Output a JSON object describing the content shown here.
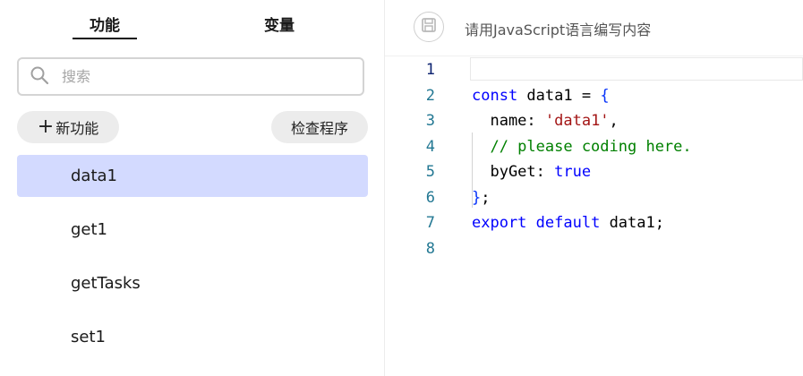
{
  "tabs": {
    "functions_label": "功能",
    "variables_label": "变量"
  },
  "search": {
    "placeholder": "搜索",
    "value": ""
  },
  "buttons": {
    "new_function_plus": "+",
    "new_function_label": "新功能",
    "check_program_label": "检查程序"
  },
  "function_list": [
    {
      "label": "data1",
      "active": true
    },
    {
      "label": "get1",
      "active": false
    },
    {
      "label": "getTasks",
      "active": false
    },
    {
      "label": "set1",
      "active": false
    }
  ],
  "editor": {
    "hint": "请用JavaScript语言编写内容",
    "save_icon": "save-icon",
    "lines": [
      {
        "number": "1",
        "tokens": []
      },
      {
        "number": "2",
        "tokens": [
          {
            "t": "const",
            "c": "kw"
          },
          {
            "t": " data1 = ",
            "c": ""
          },
          {
            "t": "{",
            "c": "br"
          }
        ]
      },
      {
        "number": "3",
        "tokens": [
          {
            "t": "  name: ",
            "c": ""
          },
          {
            "t": "'data1'",
            "c": "str"
          },
          {
            "t": ",",
            "c": ""
          }
        ]
      },
      {
        "number": "4",
        "tokens": [
          {
            "t": "  // please coding here.",
            "c": "cmt"
          }
        ]
      },
      {
        "number": "5",
        "tokens": [
          {
            "t": "  byGet: ",
            "c": ""
          },
          {
            "t": "true",
            "c": "kw"
          }
        ]
      },
      {
        "number": "6",
        "tokens": [
          {
            "t": "}",
            "c": "br"
          },
          {
            "t": ";",
            "c": ""
          }
        ]
      },
      {
        "number": "7",
        "tokens": [
          {
            "t": "export",
            "c": "kw"
          },
          {
            "t": " ",
            "c": ""
          },
          {
            "t": "default",
            "c": "kw"
          },
          {
            "t": " data1;",
            "c": ""
          }
        ]
      },
      {
        "number": "8",
        "tokens": []
      }
    ]
  },
  "colors": {
    "active_item_bg": "#d3daff",
    "keyword": "#0000ff",
    "string": "#a31515",
    "comment": "#008000",
    "line_number": "#237893"
  }
}
